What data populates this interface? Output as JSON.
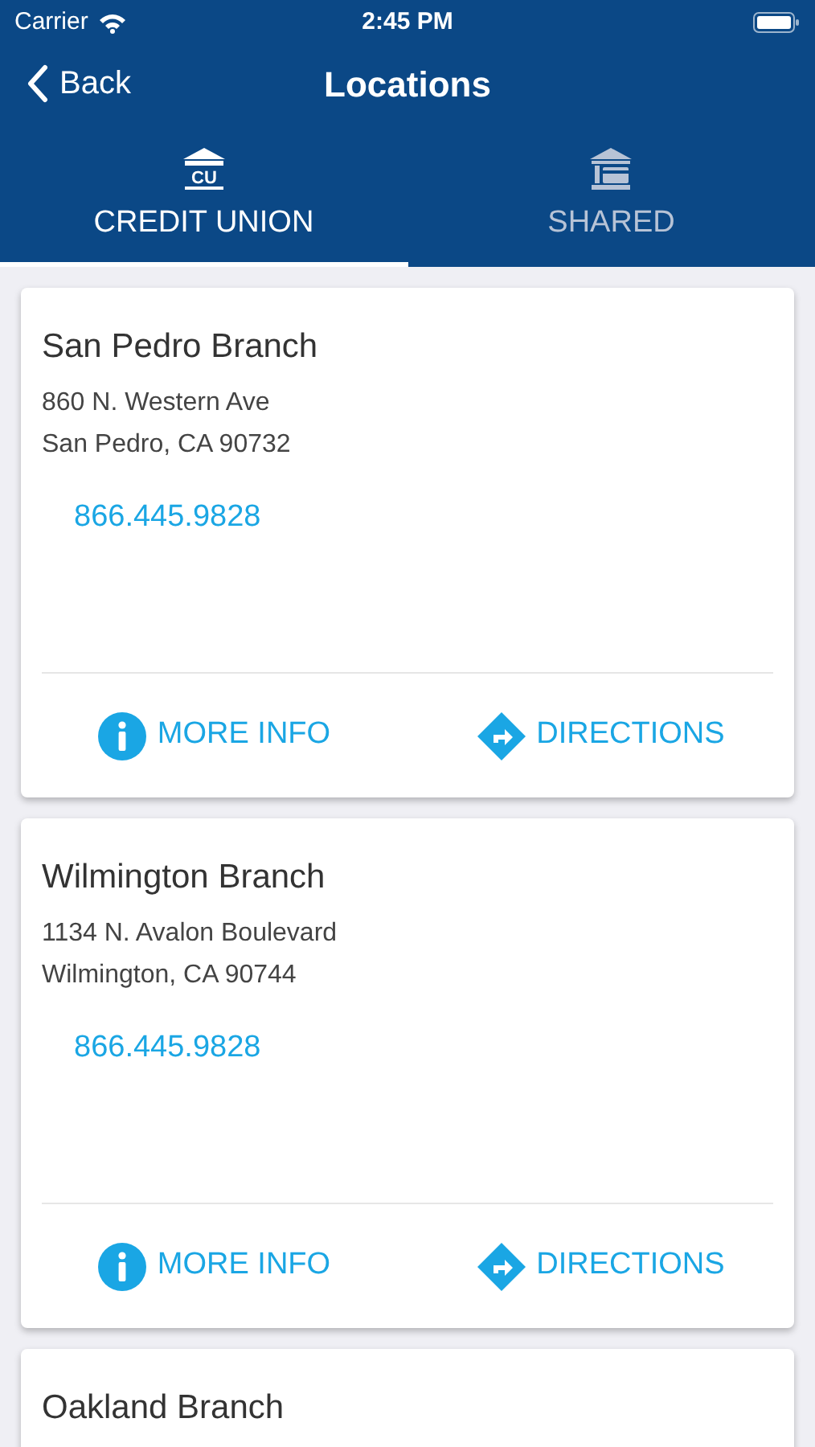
{
  "status_bar": {
    "carrier": "Carrier",
    "time": "2:45 PM"
  },
  "nav": {
    "back": "Back",
    "title": "Locations"
  },
  "tabs": [
    {
      "label": "CREDIT UNION",
      "icon_text": "CU",
      "kind": "cu",
      "selected": true
    },
    {
      "label": "SHARED",
      "kind": "shared",
      "selected": false
    }
  ],
  "branches": [
    {
      "name": "San Pedro Branch",
      "address": [
        "860 N. Western Ave",
        "San Pedro, CA 90732"
      ],
      "phone": "866.445.9828",
      "actions": [
        "MORE INFO",
        "DIRECTIONS"
      ]
    },
    {
      "name": "Wilmington Branch",
      "address": [
        "1134 N. Avalon Boulevard",
        "Wilmington, CA 90744"
      ],
      "phone": "866.445.9828",
      "actions": [
        "MORE INFO",
        "DIRECTIONS"
      ]
    },
    {
      "name": "Oakland Branch"
    }
  ]
}
